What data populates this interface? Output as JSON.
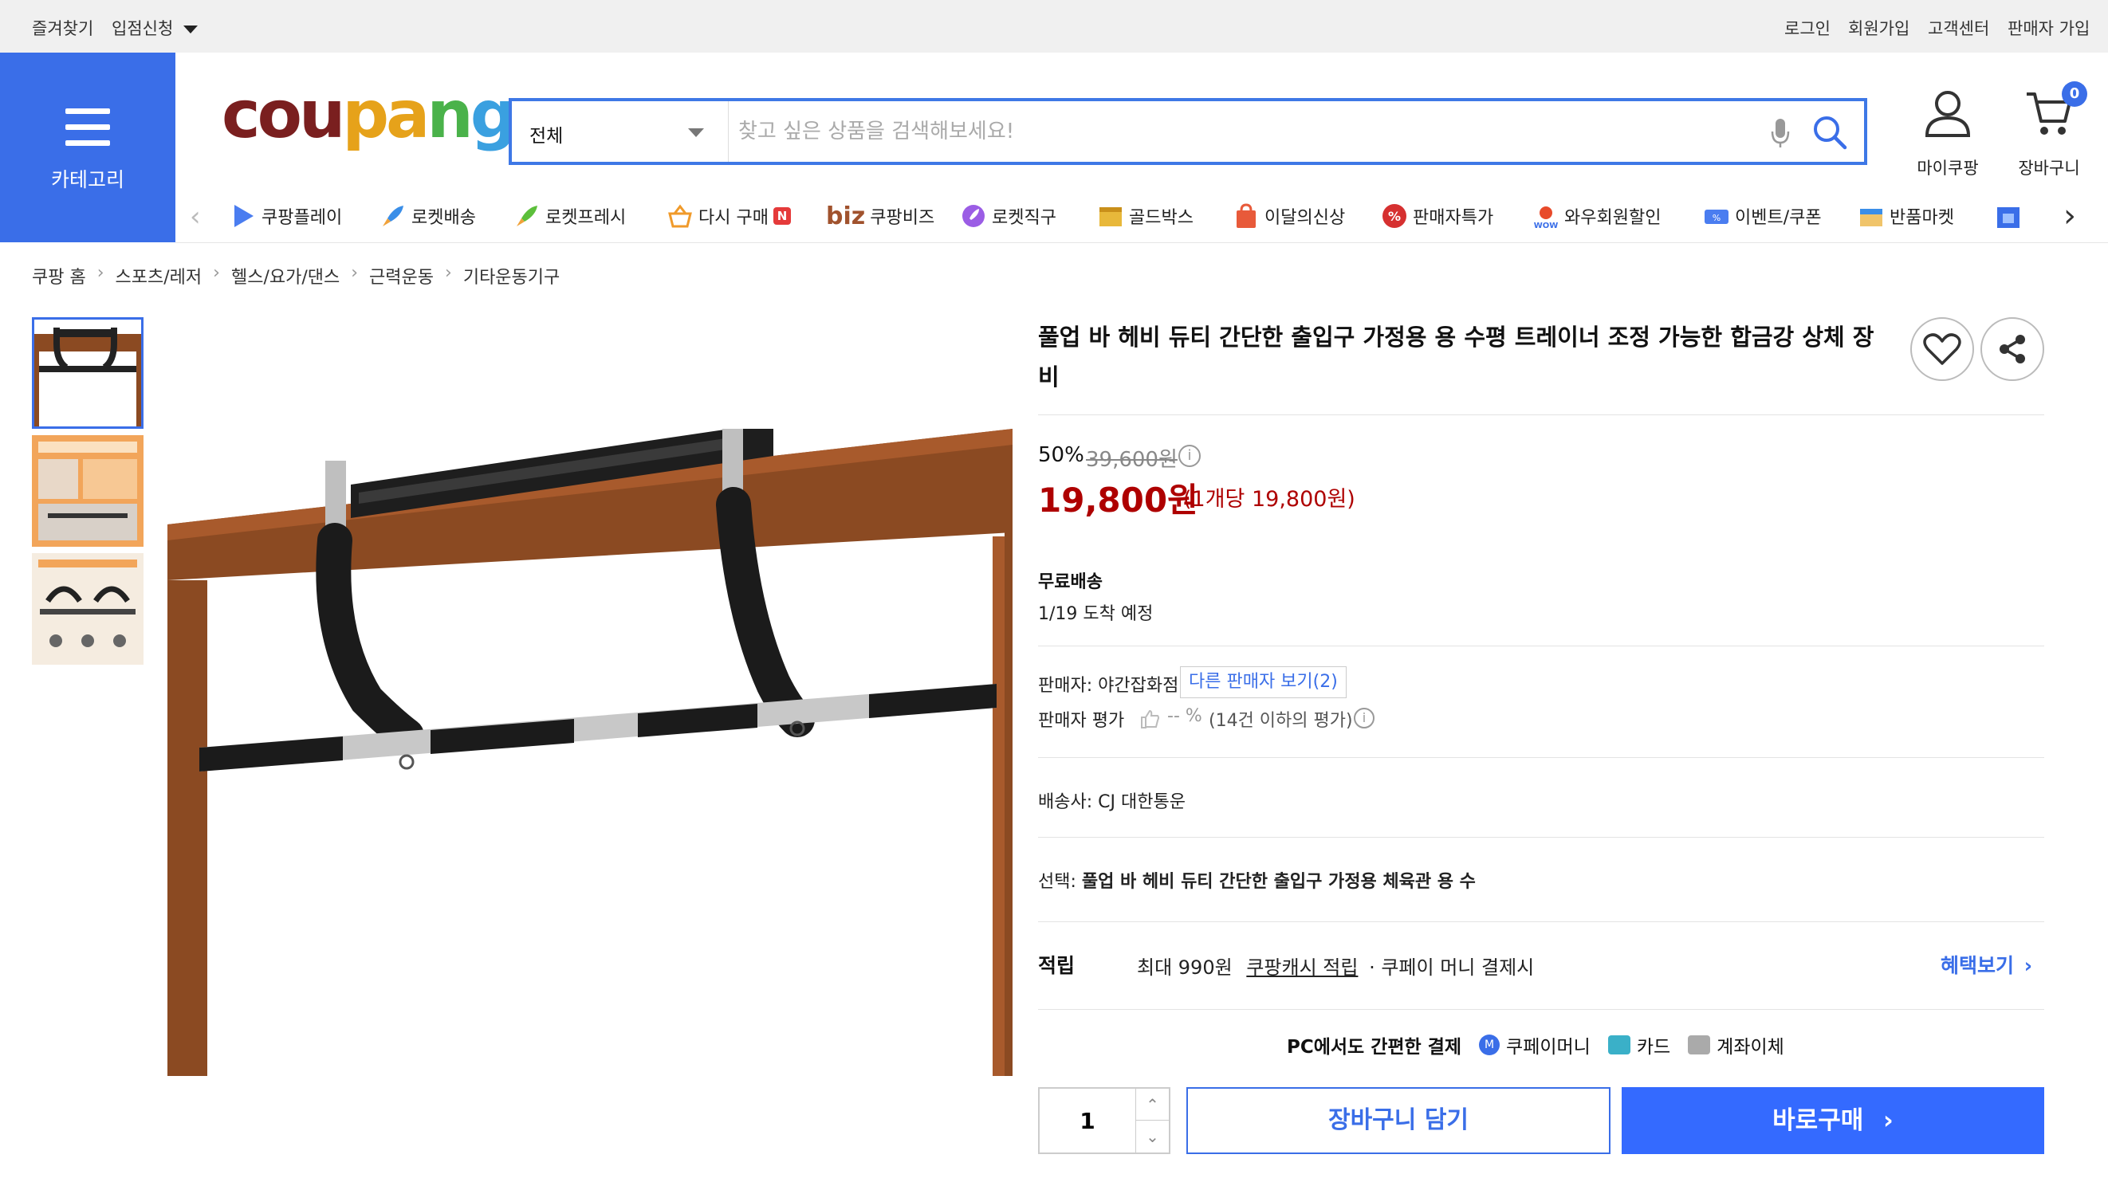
{
  "topbar": {
    "bookmark": "즐겨찾기",
    "apply": "입점신청",
    "login": "로그인",
    "signup": "회원가입",
    "support": "고객센터",
    "seller_join": "판매자 가입"
  },
  "header": {
    "category_label": "카테고리",
    "logo": "coupang",
    "search_category": "전체",
    "search_placeholder": "찾고 싶은 상품을 검색해보세요!",
    "my_coupang": "마이쿠팡",
    "cart": "장바구니",
    "cart_count": "0"
  },
  "nav": {
    "items": [
      {
        "label": "쿠팡플레이",
        "icon": "play-icon",
        "color": "#4a7df0"
      },
      {
        "label": "로켓배송",
        "icon": "rocket-icon",
        "color": "#3a8ee8"
      },
      {
        "label": "로켓프레시",
        "icon": "rocket-fresh-icon",
        "color": "#5cbf3b"
      },
      {
        "label": "다시 구매",
        "icon": "basket-icon",
        "color": "#f09a2a"
      },
      {
        "label": "쿠팡비즈",
        "icon": "biz-icon",
        "color": "#a0522d"
      },
      {
        "label": "로켓직구",
        "icon": "rocket-global-icon",
        "color": "#9b5de5"
      },
      {
        "label": "골드박스",
        "icon": "goldbox-icon",
        "color": "#e8b83a"
      },
      {
        "label": "이달의신상",
        "icon": "new-bag-icon",
        "color": "#e85a3a"
      },
      {
        "label": "판매자특가",
        "icon": "percent-icon",
        "color": "#d63030"
      },
      {
        "label": "와우회원할인",
        "icon": "wow-icon",
        "color": "#e84a2a"
      },
      {
        "label": "이벤트/쿠폰",
        "icon": "coupon-icon",
        "color": "#4a7df0"
      },
      {
        "label": "반품마켓",
        "icon": "return-market-icon",
        "color": "#f0a23a"
      }
    ],
    "new_badge": "N",
    "biz_prefix": "biz"
  },
  "breadcrumb": [
    "쿠팡 홈",
    "스포츠/레저",
    "헬스/요가/댄스",
    "근력운동",
    "기타운동기구"
  ],
  "product": {
    "title": "풀업 바 헤비 듀티 간단한 출입구 가정용 용 수평 트레이너 조정 가능한 합금강 상체 장비",
    "discount": "50%",
    "original_price": "39,600원",
    "price": "19,800원",
    "unit_price": "(1개당 19,800원)",
    "shipping_label": "무료배송",
    "arrival": "1/19 도착 예정",
    "seller_label": "판매자: ",
    "seller_name": "야간잡화점",
    "other_sellers": "다른 판매자 보기(2)",
    "rating_label": "판매자 평가",
    "rating_value": "-- %",
    "rating_note": "(14건 이하의 평가)",
    "courier_label": "배송사: ",
    "courier": "CJ 대한통운",
    "option_label": "선택: ",
    "option_value": "풀업 바 헤비 듀티 간단한 출입구 가정용 체육관 용 수",
    "reward_label": "적립",
    "reward_max": "최대 990원",
    "reward_cash": "쿠팡캐시 적립",
    "reward_pay": "· 쿠페이 머니 결제시",
    "benefit_link": "혜택보기",
    "pay_title": "PC에서도 간편한 결제",
    "pay_methods": [
      {
        "label": "쿠페이머니",
        "icon": "coupay-money-icon",
        "color": "#3a6ee8"
      },
      {
        "label": "카드",
        "icon": "card-icon",
        "color": "#3ab0c8"
      },
      {
        "label": "계좌이체",
        "icon": "bank-transfer-icon",
        "color": "#aaaaaa"
      }
    ],
    "quantity": "1",
    "add_to_cart": "장바구니 담기",
    "buy_now": "바로구매"
  }
}
